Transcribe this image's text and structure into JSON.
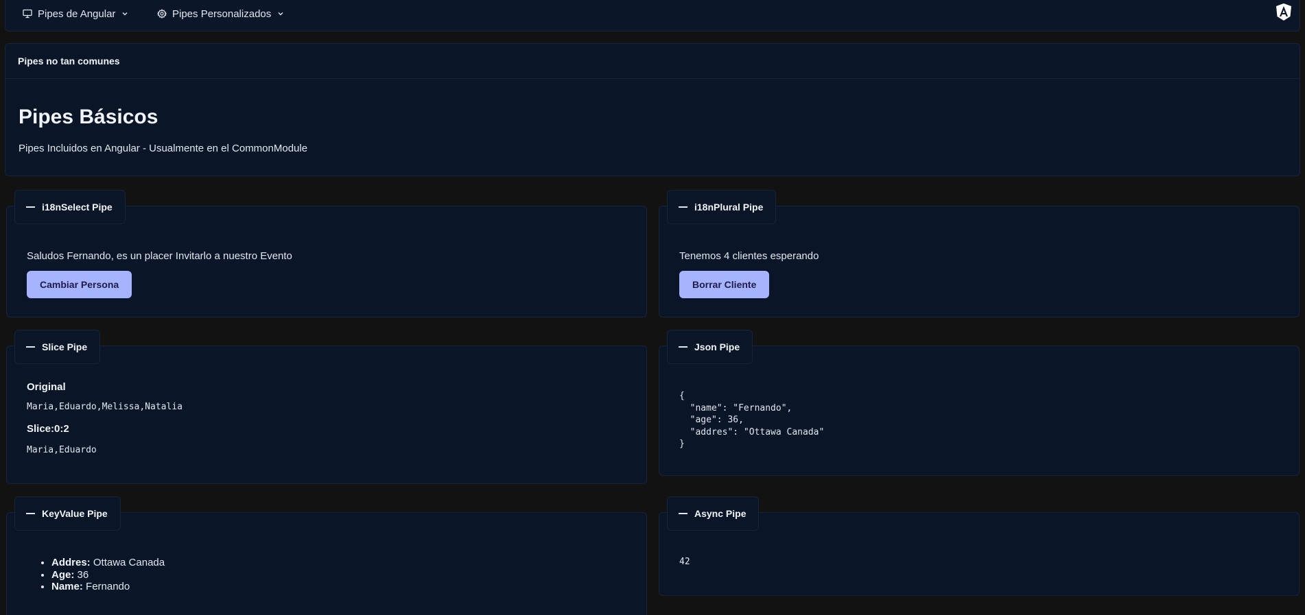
{
  "menu": {
    "items": [
      {
        "label": "Pipes de Angular",
        "icon": "monitor-icon"
      },
      {
        "label": "Pipes Personalizados",
        "icon": "gear-icon"
      }
    ],
    "logo": "angular-logo"
  },
  "header": {
    "panel_title": "Pipes no tan comunes",
    "title": "Pipes Básicos",
    "subtitle": "Pipes Incluidos en Angular - Usualmente en el CommonModule"
  },
  "cards": {
    "i18n_select": {
      "legend": "i18nSelect Pipe",
      "text": "Saludos Fernando, es un placer Invitarlo a nuestro Evento",
      "button": "Cambiar Persona"
    },
    "i18n_plural": {
      "legend": "i18nPlural Pipe",
      "text": "Tenemos 4 clientes esperando",
      "button": "Borrar Cliente"
    },
    "slice": {
      "legend": "Slice Pipe",
      "original_label": "Original",
      "original_value": "Maria,Eduardo,Melissa,Natalia",
      "slice_label": "Slice:0:2",
      "slice_value": "Maria,Eduardo"
    },
    "json": {
      "legend": "Json Pipe",
      "value": "{\n  \"name\": \"Fernando\",\n  \"age\": 36,\n  \"addres\": \"Ottawa Canada\"\n}"
    },
    "keyvalue": {
      "legend": "KeyValue Pipe",
      "items": [
        {
          "key": "Addres:",
          "value": "Ottawa Canada"
        },
        {
          "key": "Age:",
          "value": "36"
        },
        {
          "key": "Name:",
          "value": "Fernando"
        }
      ]
    },
    "async": {
      "legend": "Async Pipe",
      "value": "42"
    }
  },
  "colors": {
    "background": "#121212",
    "panel": "#0a1527",
    "border": "#16243b",
    "button": "#a5b4fc",
    "button_text": "#1e1b4b"
  }
}
